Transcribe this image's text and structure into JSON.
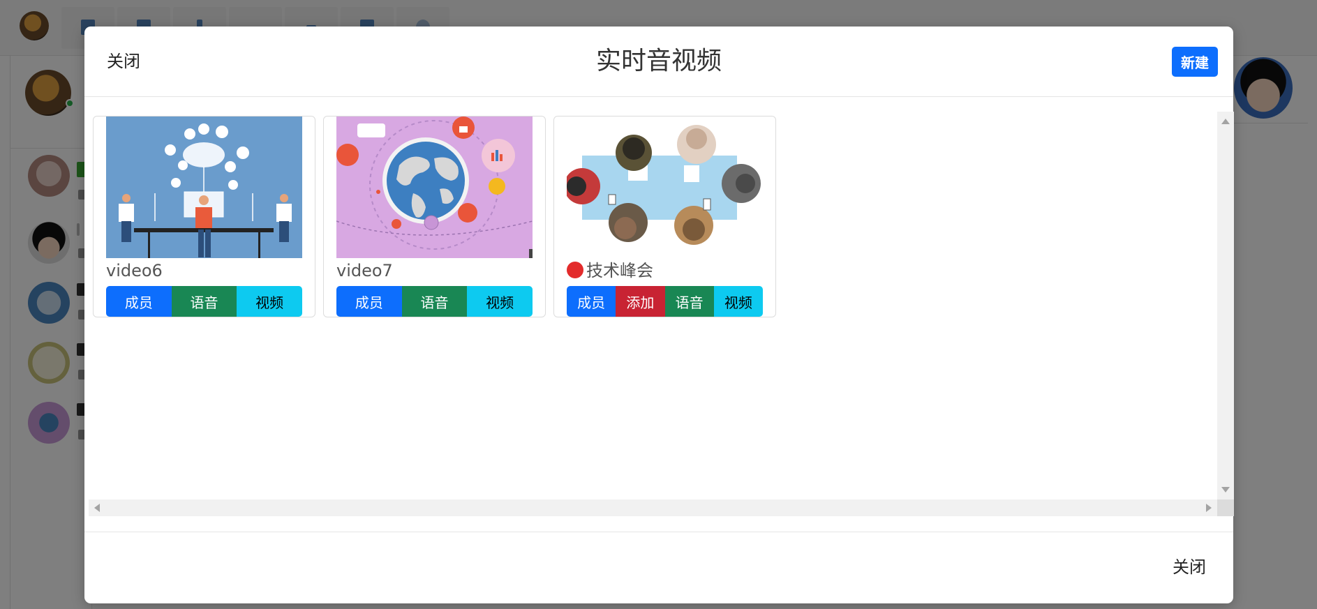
{
  "modal": {
    "title": "实时音视频",
    "header_close_label": "关闭",
    "new_label": "新建",
    "footer_close_label": "关闭"
  },
  "rooms": [
    {
      "name": "video6",
      "live": false,
      "thumbnail": "tech-office-illustration",
      "buttons": [
        {
          "label": "成员",
          "style": "primary"
        },
        {
          "label": "语音",
          "style": "success"
        },
        {
          "label": "视频",
          "style": "info"
        }
      ]
    },
    {
      "name": "video7",
      "live": false,
      "thumbnail": "globe-network-illustration",
      "buttons": [
        {
          "label": "成员",
          "style": "primary"
        },
        {
          "label": "语音",
          "style": "success"
        },
        {
          "label": "视频",
          "style": "info"
        }
      ]
    },
    {
      "name": "技术峰会",
      "live": true,
      "thumbnail": "meeting-table-illustration",
      "buttons": [
        {
          "label": "成员",
          "style": "primary"
        },
        {
          "label": "添加",
          "style": "danger"
        },
        {
          "label": "语音",
          "style": "success"
        },
        {
          "label": "视频",
          "style": "info"
        }
      ]
    }
  ],
  "colors": {
    "primary": "#0d6efd",
    "success": "#198754",
    "info": "#0dcaf0",
    "danger": "#c82333",
    "live_dot": "#e32b2b",
    "overlay": "rgba(0,0,0,0.5)"
  }
}
